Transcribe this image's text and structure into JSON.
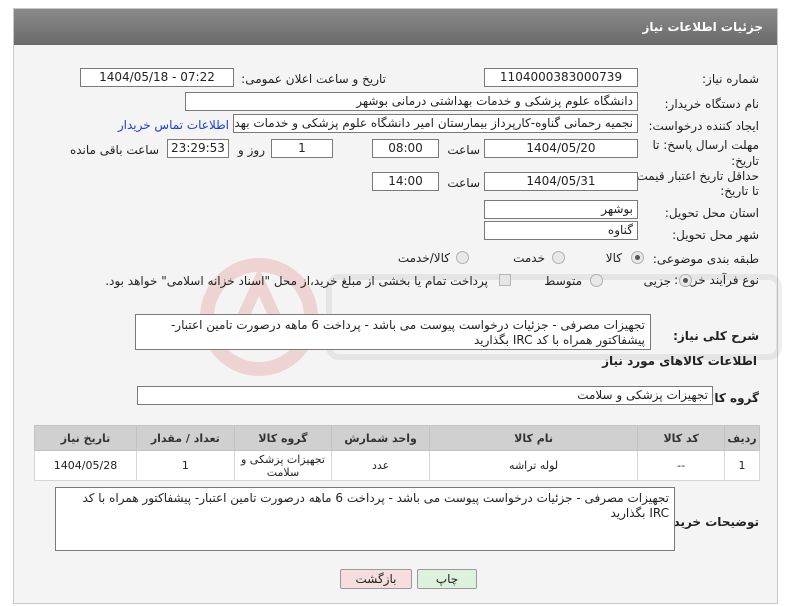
{
  "page": {
    "title": "جزئیات اطلاعات نیاز"
  },
  "fields": {
    "need_number_label": "شماره نیاز:",
    "need_number": "1104000383000739",
    "announce_label": "تاریخ و ساعت اعلان عمومی:",
    "announce_value": "1404/05/18 - 07:22",
    "buyer_label": "نام دستگاه خریدار:",
    "buyer_value": "دانشگاه علوم پزشکی و خدمات بهداشتی درمانی بوشهر",
    "creator_label": "ایجاد کننده درخواست:",
    "creator_value": "نجمیه رحمانی گناوه-کارپرداز بیمارستان امیر دانشگاه علوم پزشکی و خدمات بهد",
    "contact_link": "اطلاعات تماس خریدار",
    "deadline_label": "مهلت ارسال پاسخ: تا تاریخ:",
    "deadline_date": "1404/05/20",
    "time_label": "ساعت",
    "deadline_time": "08:00",
    "days_value": "1",
    "days_label": "روز و",
    "remaining_value": "23:29:53",
    "remaining_label": "ساعت باقی مانده",
    "validity_label": "حداقل تاریخ اعتبار قیمت: تا تاریخ:",
    "validity_date": "1404/05/31",
    "validity_time": "14:00",
    "province_label": "استان محل تحویل:",
    "province_value": "بوشهر",
    "city_label": "شهر محل تحویل:",
    "city_value": "گناوه",
    "category_label": "طبقه بندی موضوعی:",
    "category_options": [
      "کالا",
      "خدمت",
      "کالا/خدمت"
    ],
    "process_label": "نوع فرآیند خرید :",
    "process_options": [
      "جزیی",
      "متوسط"
    ],
    "payment_note": "پرداخت تمام یا بخشی از مبلغ خرید،از محل \"اسناد خزانه اسلامی\" خواهد بود.",
    "description_label": "شرح کلی نیاز:",
    "description_value": "تجهیزات مصرفی - جزئیات درخواست پیوست می باشد - پرداخت 6 ماهه درصورت تامین اعتبار- پیشفاکتور همراه با کد IRC بگذارید"
  },
  "goods": {
    "section_title": "اطلاعات کالاهای مورد نیاز",
    "group_label": "گروه کالا:",
    "group_value": "تجهیزات پزشکی و سلامت",
    "columns": [
      "ردیف",
      "کد کالا",
      "نام کالا",
      "واحد شمارش",
      "گروه کالا",
      "تعداد / مقدار",
      "تاریخ نیاز"
    ],
    "rows": [
      {
        "row": "1",
        "code": "--",
        "name": "لوله تراشه",
        "unit": "عدد",
        "group": "تجهیزات پزشکی و سلامت",
        "qty": "1",
        "date": "1404/05/28"
      }
    ]
  },
  "buyer_notes": {
    "label": "توضیحات خریدار:",
    "value": "تجهیزات مصرفی - جزئیات درخواست پیوست می باشد - پرداخت 6 ماهه درصورت تامین اعتبار- پیشفاکتور همراه با کد IRC بگذارید"
  },
  "buttons": {
    "print": "چاپ",
    "back": "بازگشت"
  },
  "colors": {
    "header_bg": "#777777",
    "link": "#1a3fd8",
    "back_button_bg": "#f7dede",
    "print_button_bg": "#dcf2dc"
  }
}
